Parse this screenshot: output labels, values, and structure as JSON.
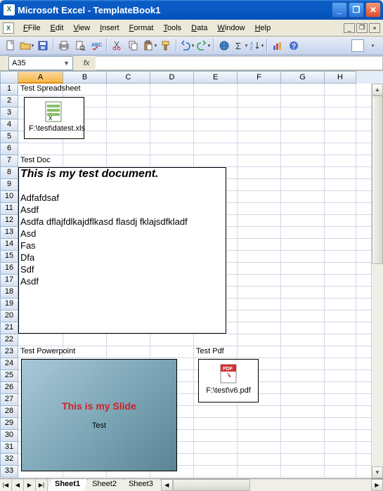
{
  "window": {
    "title": "Microsoft Excel - TemplateBook1"
  },
  "menus": [
    "File",
    "Edit",
    "View",
    "Insert",
    "Format",
    "Tools",
    "Data",
    "Window",
    "Help"
  ],
  "namebox": "A35",
  "formula": "",
  "columns": [
    "A",
    "B",
    "C",
    "D",
    "E",
    "F",
    "G",
    "H"
  ],
  "row_count": 33,
  "cells": {
    "A1": "Test Spreadsheet",
    "A7": "Test Doc",
    "A23": "Test Powerpoint",
    "E23": "Test Pdf"
  },
  "embedded": {
    "xls_icon": {
      "caption": "F:\\test\\datest.xls"
    },
    "doc": {
      "heading": "This is my test document.",
      "lines": [
        "",
        "Adfafdsaf",
        "Asdf",
        "Asdfa dflajfdlkajdflkasd flasdj fklajsdfkladf",
        "Asd",
        "Fas",
        "Dfa",
        "Sdf",
        "Asdf",
        "",
        "",
        ""
      ]
    },
    "ppt": {
      "title": "This is my Slide",
      "sub": "Test"
    },
    "pdf": {
      "caption": "F:\\test\\v6.pdf"
    }
  },
  "sheets": [
    "Sheet1",
    "Sheet2",
    "Sheet3"
  ],
  "active_sheet": 0
}
